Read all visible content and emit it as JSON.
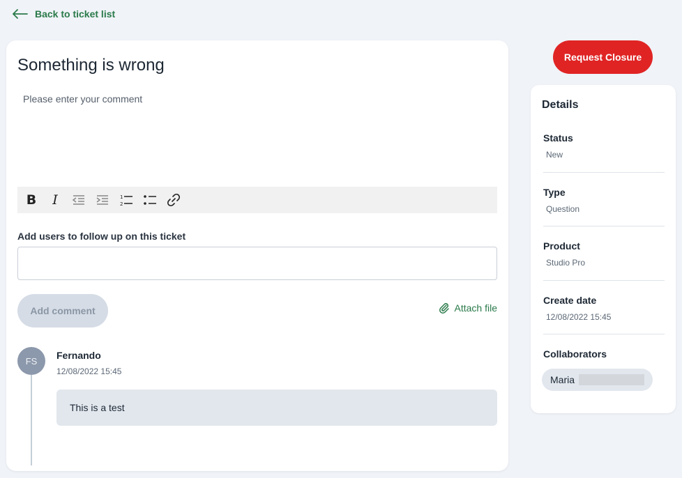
{
  "nav": {
    "back_label": "Back to ticket list"
  },
  "ticket": {
    "title": "Something is wrong",
    "comment_placeholder": "Please enter your comment"
  },
  "toolbar": {
    "bold_label": "B",
    "italic_label": "I"
  },
  "follow": {
    "label": "Add users to follow up on this ticket",
    "value": ""
  },
  "actions": {
    "add_comment_label": "Add comment",
    "attach_file_label": "Attach file",
    "request_closure_label": "Request Closure"
  },
  "comments": [
    {
      "initials": "FS",
      "author": "Fernando",
      "date": "12/08/2022 15:45",
      "text": "This is a test"
    }
  ],
  "details": {
    "heading": "Details",
    "items": [
      {
        "label": "Status",
        "value": "New"
      },
      {
        "label": "Type",
        "value": "Question"
      },
      {
        "label": "Product",
        "value": "Studio Pro"
      },
      {
        "label": "Create date",
        "value": "12/08/2022 15:45"
      }
    ],
    "collaborators_label": "Collaborators",
    "collaborators": [
      {
        "name": "Maria"
      }
    ]
  },
  "colors": {
    "accent_green": "#2a7a4a",
    "danger_red": "#e02424",
    "background": "#f0f3f8"
  }
}
